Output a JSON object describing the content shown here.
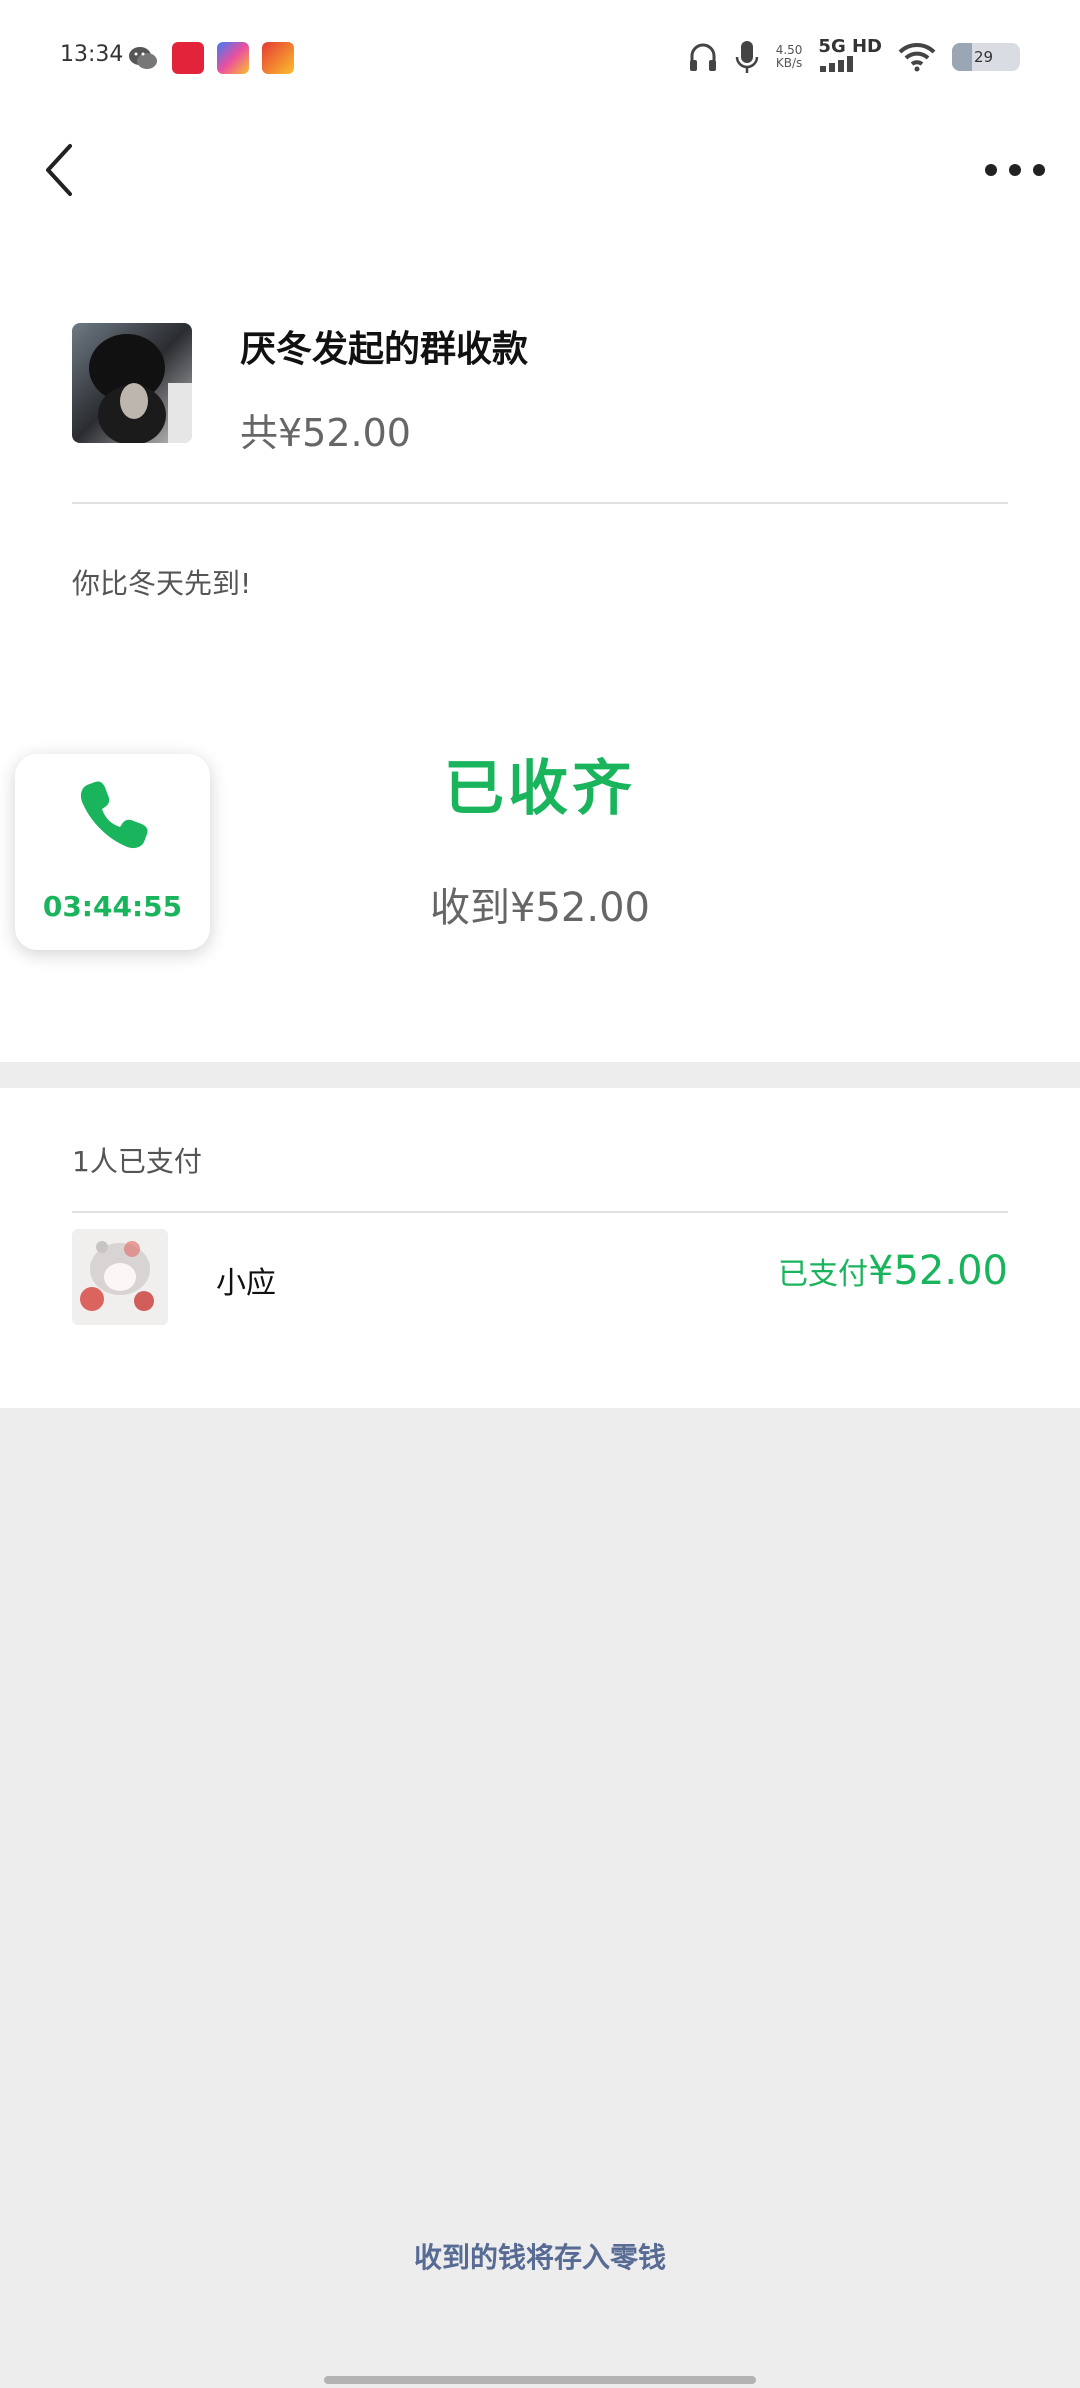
{
  "status_bar": {
    "time": "13:34",
    "net_speed_value": "4.50",
    "net_speed_unit": "KB/s",
    "network": "5G HD",
    "battery": "29",
    "battery_level": 0.29
  },
  "header": {
    "back_icon": "chevron-left-icon",
    "more_icon": "more-dots-icon"
  },
  "collection": {
    "title": "厌冬发起的群收款",
    "total": "共¥52.00",
    "note": "你比冬天先到!",
    "status": "已收齐",
    "received": "收到¥52.00"
  },
  "call_widget": {
    "icon": "phone-icon",
    "duration": "03:44:55"
  },
  "payments": {
    "paid_count": "1人已支付",
    "items": [
      {
        "name": "小应",
        "status_prefix": "已支付",
        "amount": "¥52.00"
      }
    ]
  },
  "footer": {
    "link": "收到的钱将存入零钱"
  },
  "colors": {
    "accent_green": "#19b45c",
    "link_blue": "#576b95",
    "page_bg": "#ededed"
  }
}
